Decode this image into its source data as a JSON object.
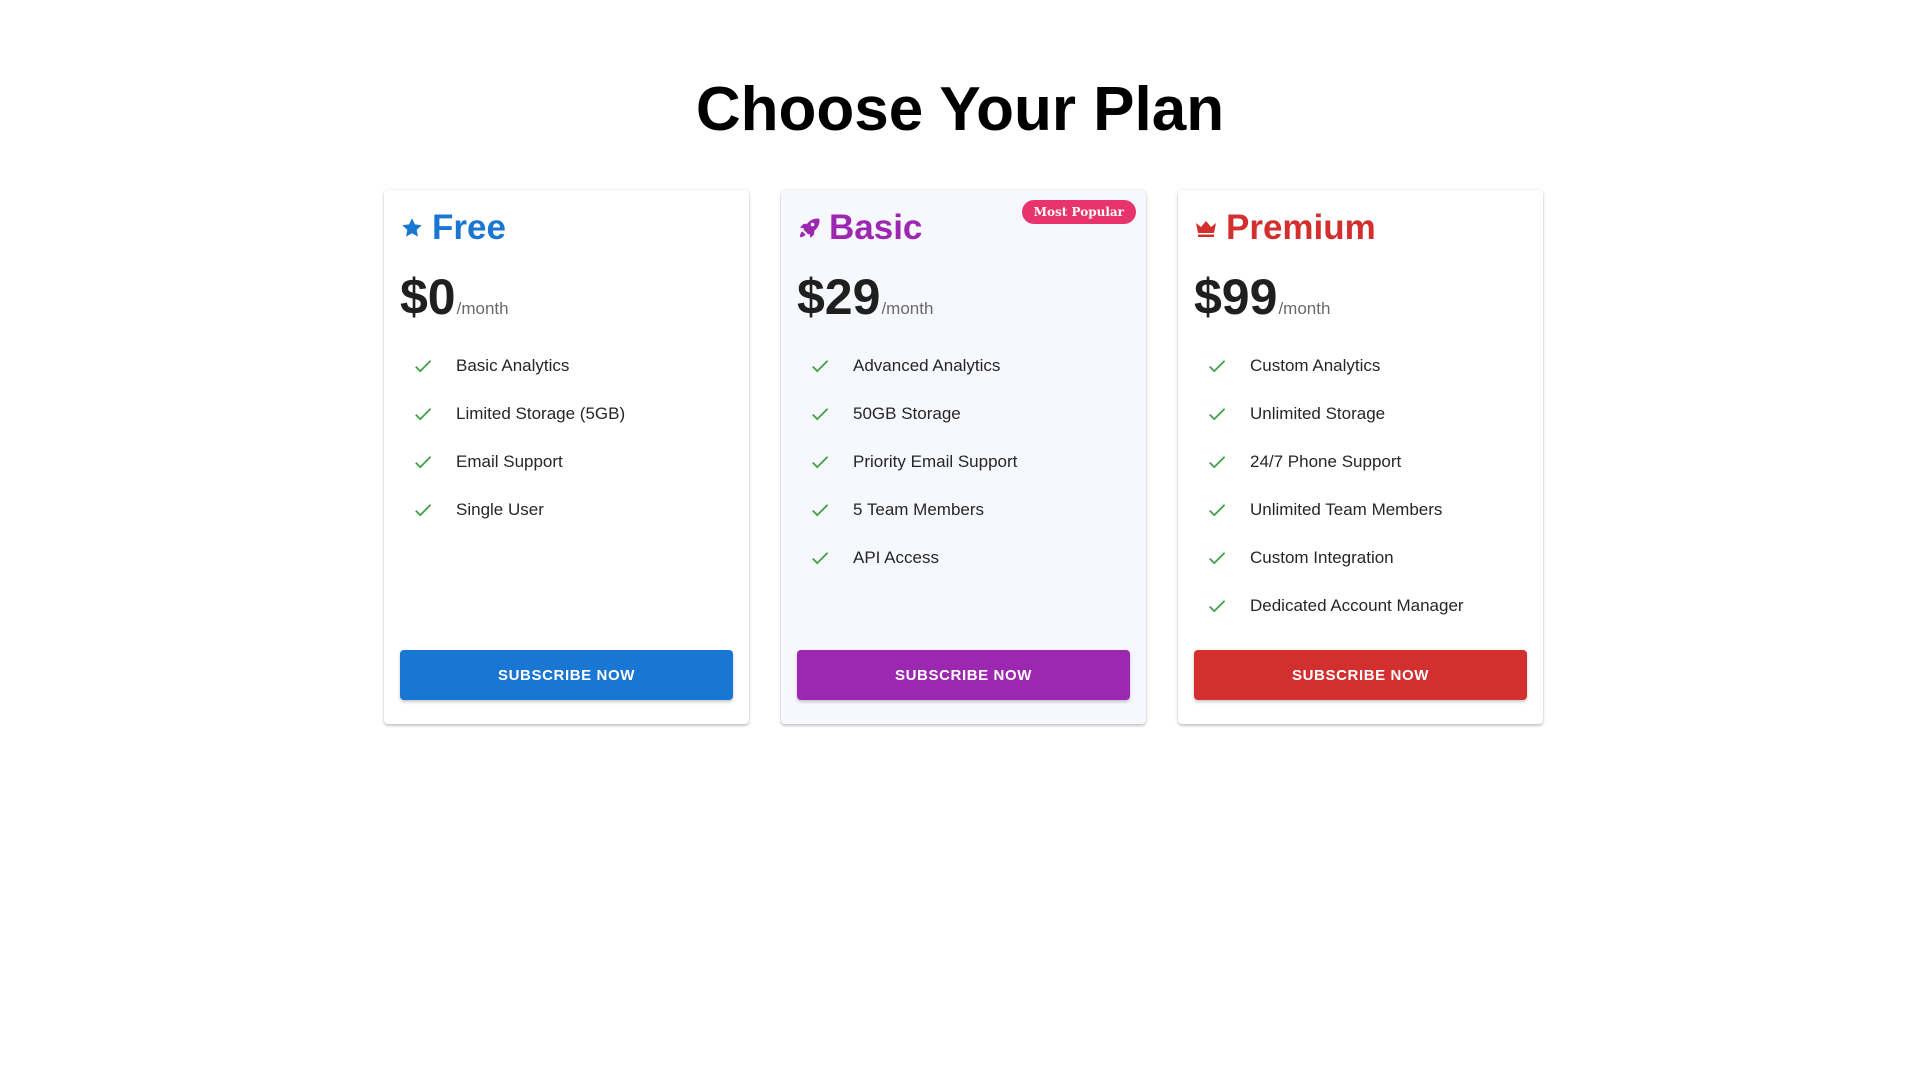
{
  "page": {
    "title": "Choose Your Plan"
  },
  "plans": [
    {
      "name": "Free",
      "icon": "star-icon",
      "accent": "#1976d2",
      "price": "$0",
      "period": "/month",
      "badge": "",
      "features": [
        "Basic Analytics",
        "Limited Storage (5GB)",
        "Email Support",
        "Single User"
      ],
      "cta": "SUBSCRIBE NOW"
    },
    {
      "name": "Basic",
      "icon": "rocket-icon",
      "accent": "#9c27b0",
      "price": "$29",
      "period": "/month",
      "badge": "Most Popular",
      "features": [
        "Advanced Analytics",
        "50GB Storage",
        "Priority Email Support",
        "5 Team Members",
        "API Access"
      ],
      "cta": "SUBSCRIBE NOW"
    },
    {
      "name": "Premium",
      "icon": "crown-icon",
      "accent": "#d32f2f",
      "price": "$99",
      "period": "/month",
      "badge": "",
      "features": [
        "Custom Analytics",
        "Unlimited Storage",
        "24/7 Phone Support",
        "Unlimited Team Members",
        "Custom Integration",
        "Dedicated Account Manager"
      ],
      "cta": "SUBSCRIBE NOW"
    }
  ],
  "colors": {
    "check": "#43a047",
    "badge": "#e8336c"
  }
}
